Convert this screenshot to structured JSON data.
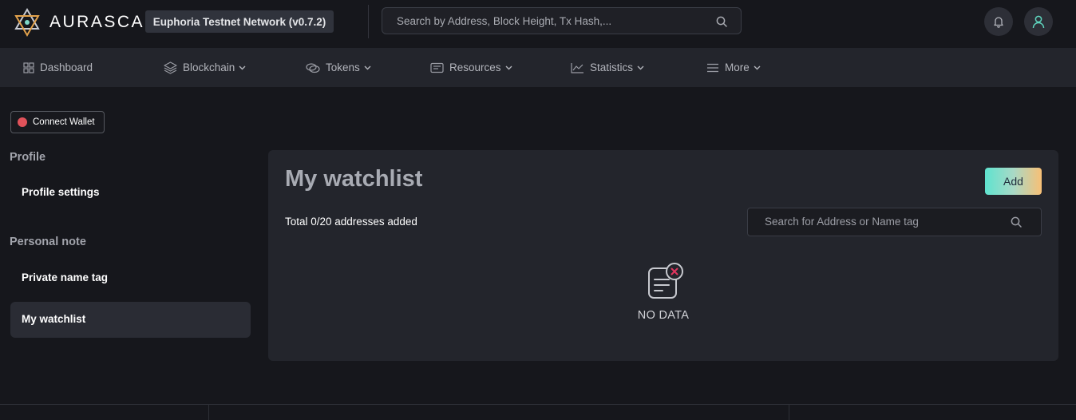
{
  "header": {
    "logo_text": "AURASCAN",
    "network_label": "Euphoria Testnet Network (v0.7.2)",
    "search_placeholder": "Search by Address, Block Height, Tx Hash,..."
  },
  "nav": [
    {
      "label": "Dashboard",
      "icon": "grid-icon"
    },
    {
      "label": "Blockchain",
      "icon": "layers-icon"
    },
    {
      "label": "Tokens",
      "icon": "coins-icon"
    },
    {
      "label": "Resources",
      "icon": "document-icon"
    },
    {
      "label": "Statistics",
      "icon": "chart-icon"
    },
    {
      "label": "More",
      "icon": "menu-icon"
    }
  ],
  "sidebar": {
    "connect_wallet": "Connect Wallet",
    "profile_heading": "Profile",
    "profile_settings": "Profile settings",
    "personal_note_heading": "Personal note",
    "private_name_tag": "Private name tag",
    "my_watchlist": "My watchlist"
  },
  "main": {
    "title": "My watchlist",
    "add_label": "Add",
    "total_text": "Total 0/20 addresses added",
    "search_placeholder": "Search for Address or Name tag",
    "no_data": "NO DATA"
  },
  "colors": {
    "background": "#16171c",
    "panel": "#23252c",
    "accent_gradient_start": "#5fe3cf",
    "accent_gradient_end": "#f8c076",
    "wallet_dot": "#e0525a",
    "no_data_x": "#e0355e"
  }
}
